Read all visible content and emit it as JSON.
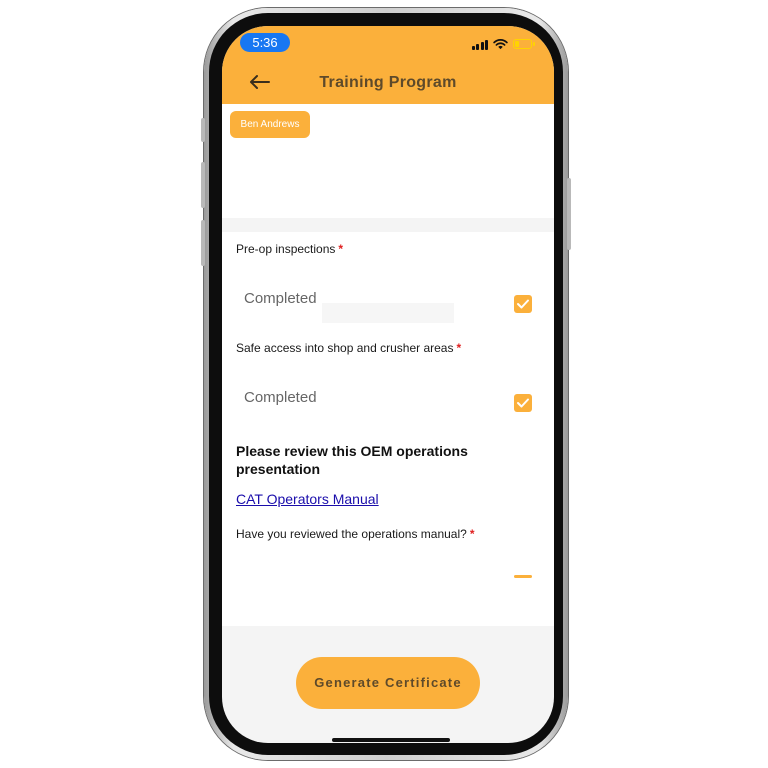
{
  "status_bar": {
    "time": "5:36"
  },
  "header": {
    "title": "Training Program"
  },
  "trainee": {
    "name": "Ben Andrews"
  },
  "form": {
    "fields": [
      {
        "label": "Pre-op inspections",
        "required_mark": "*",
        "value": "Completed",
        "checked": true
      },
      {
        "label": "Safe access into shop and crusher areas",
        "required_mark": "*",
        "value": "Completed",
        "checked": true
      }
    ],
    "section_heading": "Please review this OEM operations presentation",
    "link_text": "CAT Operators Manual",
    "question": {
      "label": "Have you reviewed the operations manual?",
      "required_mark": "*"
    }
  },
  "footer": {
    "button_label": "Generate Certificate"
  },
  "colors": {
    "accent": "#fbb03b",
    "link": "#1a0dab",
    "required": "#e02020",
    "time_pill": "#1877f2"
  }
}
